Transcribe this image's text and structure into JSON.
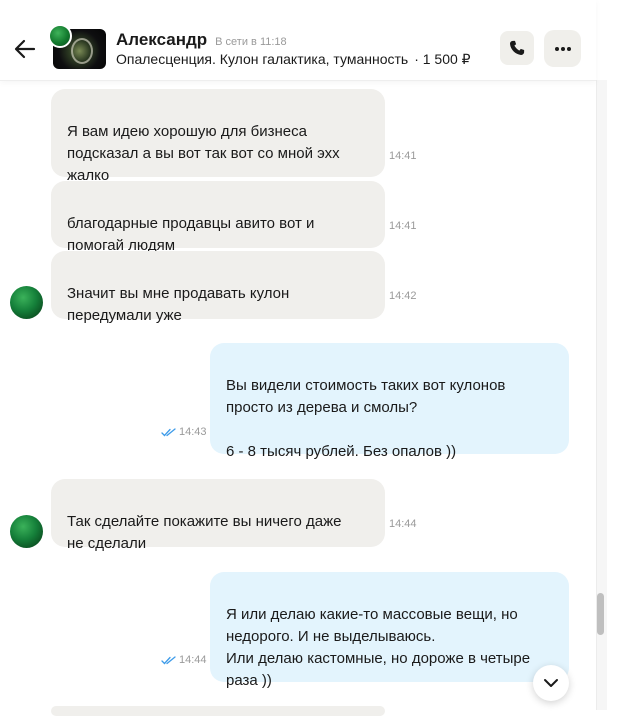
{
  "header": {
    "contact_name": "Александр",
    "status": "В сети в 11:18",
    "item_title": "Опалесценция. Кулон галактика, туманность",
    "item_price": "· 1 500 ₽"
  },
  "icons": {
    "back": "arrow-left-icon",
    "call": "phone-icon",
    "more": "more-horizontal-icon",
    "scroll_down": "chevron-down-icon",
    "read": "double-check-icon"
  },
  "colors": {
    "incoming_bubble": "#f0efec",
    "outgoing_bubble": "#e3f4fd",
    "read_check": "#3d9be9"
  },
  "messages": [
    {
      "direction": "in",
      "text": "Я вам идею хорошую для бизнеса\nподсказал а вы вот так вот со мной эхх\nжалко",
      "time": "14:41"
    },
    {
      "direction": "in",
      "text": "благодарные продавцы авито вот и\nпомогай людям",
      "time": "14:41"
    },
    {
      "direction": "in",
      "text": "Значит вы мне продавать кулон\nпередумали уже",
      "time": "14:42"
    },
    {
      "direction": "out",
      "text": "Вы видели стоимость таких вот кулонов\nпросто из дерева и смолы?\n\n6 - 8 тысяч рублей. Без опалов ))",
      "time": "14:43"
    },
    {
      "direction": "in",
      "text": "Так сделайте покажите вы ничего даже\nне сделали",
      "time": "14:44"
    },
    {
      "direction": "out",
      "text": "Я или делаю какие-то массовые вещи, но\nнедорого. И не выделываюсь.\nИли делаю кастомные, но дороже в четыре\nраза ))",
      "time": "14:44"
    }
  ]
}
